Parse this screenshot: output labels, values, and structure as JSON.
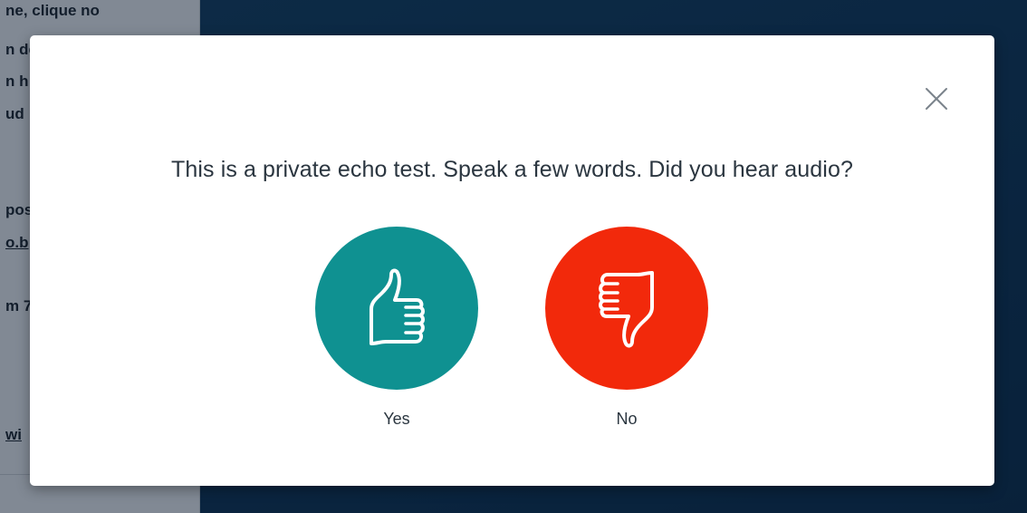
{
  "side_panel": {
    "lines": [
      "ne, clique no",
      "n de",
      "n h",
      "ud",
      "pos",
      "o.b",
      "m 7",
      "wi"
    ]
  },
  "modal": {
    "prompt": "This is a private echo test. Speak a few words. Did you hear audio?",
    "close_icon": "close-icon",
    "yes": {
      "label": "Yes",
      "icon": "thumbs-up-icon",
      "color": "#0f9191"
    },
    "no": {
      "label": "No",
      "icon": "thumbs-down-icon",
      "color": "#f2290b"
    }
  },
  "colors": {
    "background": "#0d2f4c",
    "modal": "#ffffff",
    "text": "#2b3640"
  }
}
